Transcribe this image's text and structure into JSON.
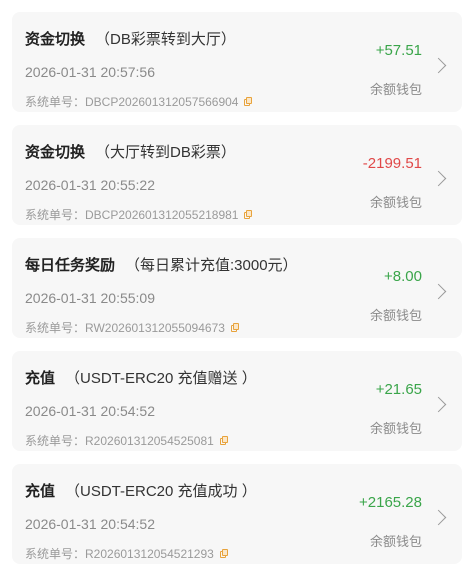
{
  "records": [
    {
      "title": "资金切换",
      "subtitle": "（DB彩票转到大厅）",
      "time": "2026-01-31 20:57:56",
      "order_label": "系统单号：",
      "order_no": "DBCP202601312057566904",
      "amount": "+57.51",
      "amount_type": "positive",
      "wallet": "余额钱包"
    },
    {
      "title": "资金切换",
      "subtitle": "（大厅转到DB彩票）",
      "time": "2026-01-31 20:55:22",
      "order_label": "系统单号：",
      "order_no": "DBCP202601312055218981",
      "amount": "-2199.51",
      "amount_type": "negative",
      "wallet": "余额钱包"
    },
    {
      "title": "每日任务奖励",
      "subtitle": "（每日累计充值:3000元）",
      "time": "2026-01-31 20:55:09",
      "order_label": "系统单号：",
      "order_no": "RW202601312055094673",
      "amount": "+8.00",
      "amount_type": "positive",
      "wallet": "余额钱包"
    },
    {
      "title": "充值",
      "subtitle": "（USDT-ERC20 充值赠送 ）",
      "time": "2026-01-31 20:54:52",
      "order_label": "系统单号：",
      "order_no": "R202601312054525081",
      "amount": "+21.65",
      "amount_type": "positive",
      "wallet": "余额钱包"
    },
    {
      "title": "充值",
      "subtitle": "（USDT-ERC20 充值成功 ）",
      "time": "2026-01-31 20:54:52",
      "order_label": "系统单号：",
      "order_no": "R202601312054521293",
      "amount": "+2165.28",
      "amount_type": "positive",
      "wallet": "余额钱包"
    }
  ],
  "colors": {
    "positive": "#3aa54a",
    "negative": "#e04848",
    "copy_icon": "#e8a33c"
  },
  "icons": {
    "copy": "copy-icon",
    "detail": "chevron-right-icon"
  }
}
